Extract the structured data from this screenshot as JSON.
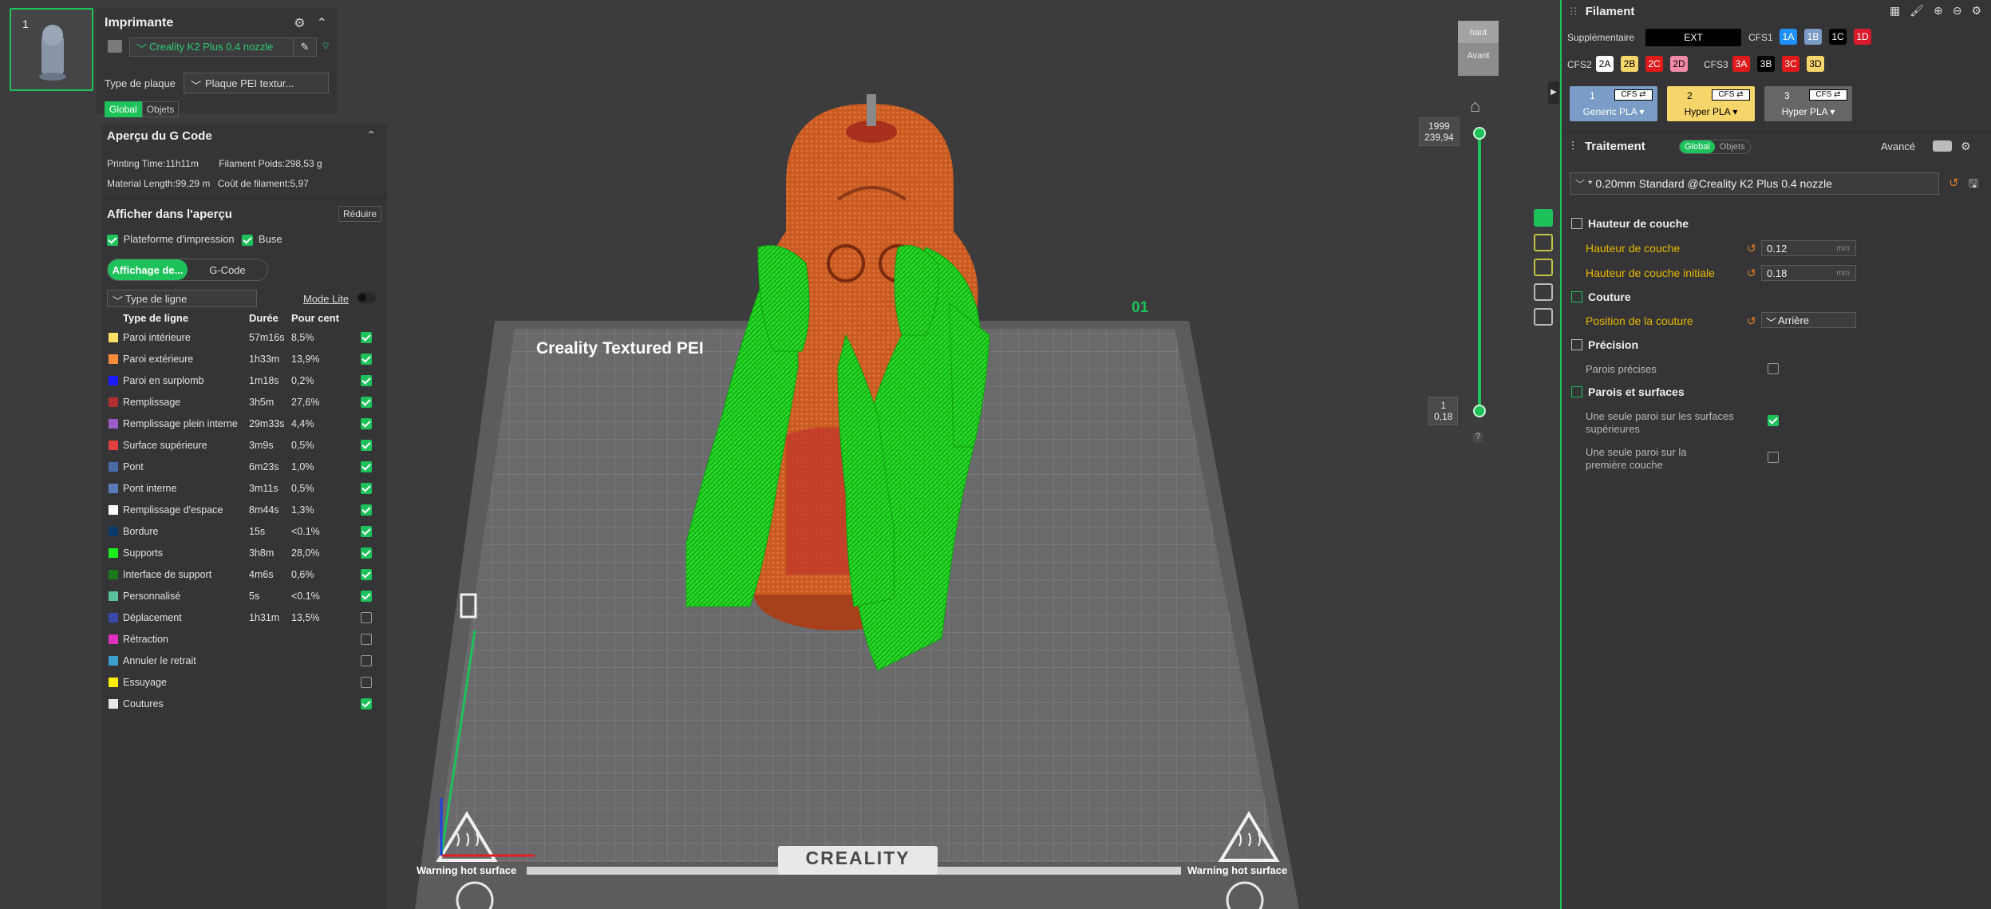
{
  "plate": {
    "number": "1"
  },
  "printer": {
    "title": "Imprimante",
    "name": "Creality K2 Plus 0.4 nozzle",
    "plate_label": "Type de plaque",
    "plate_value": "Plaque PEI textur...",
    "scope_global": "Global",
    "scope_objects": "Objets"
  },
  "gcode": {
    "title": "Aperçu du G Code",
    "printing_time": "Printing Time:11h11m",
    "filament_weight": "Filament Poids:298,53 g",
    "material_length": "Material Length:99,29 m",
    "filament_cost": "Coût de filament:5,97",
    "show_title": "Afficher dans l'aperçu",
    "reduce": "Réduire",
    "opt_plate": "Plateforme d'impression",
    "opt_nozzle": "Buse",
    "tab_display": "Affichage de...",
    "tab_gcode": "G-Code",
    "line_type_select": "Type de ligne",
    "lite_mode": "Mode Lite",
    "col_type": "Type de ligne",
    "col_duration": "Durée",
    "col_percent": "Pour cent",
    "rows": [
      {
        "name": "Paroi intérieure",
        "color": "#ffe066",
        "duration": "57m16s",
        "percent": "8,5%",
        "checked": true
      },
      {
        "name": "Paroi extérieure",
        "color": "#ff8c3a",
        "duration": "1h33m",
        "percent": "13,9%",
        "checked": true
      },
      {
        "name": "Paroi en surplomb",
        "color": "#1a1aff",
        "duration": "1m18s",
        "percent": "0,2%",
        "checked": true
      },
      {
        "name": "Remplissage",
        "color": "#b03030",
        "duration": "3h5m",
        "percent": "27,6%",
        "checked": true
      },
      {
        "name": "Remplissage plein interne",
        "color": "#9a5cc6",
        "duration": "29m33s",
        "percent": "4,4%",
        "checked": true
      },
      {
        "name": "Surface supérieure",
        "color": "#e04040",
        "duration": "3m9s",
        "percent": "0,5%",
        "checked": true
      },
      {
        "name": "Pont",
        "color": "#4a6aa8",
        "duration": "6m23s",
        "percent": "1,0%",
        "checked": true
      },
      {
        "name": "Pont interne",
        "color": "#5a7ab8",
        "duration": "3m11s",
        "percent": "0,5%",
        "checked": true
      },
      {
        "name": "Remplissage d'espace",
        "color": "#ffffff",
        "duration": "8m44s",
        "percent": "1,3%",
        "checked": true
      },
      {
        "name": "Bordure",
        "color": "#0a3a6a",
        "duration": "15s",
        "percent": "<0.1%",
        "checked": true
      },
      {
        "name": "Supports",
        "color": "#1aee1a",
        "duration": "3h8m",
        "percent": "28,0%",
        "checked": true
      },
      {
        "name": "Interface de support",
        "color": "#1a7a1a",
        "duration": "4m6s",
        "percent": "0,6%",
        "checked": true
      },
      {
        "name": "Personnalisé",
        "color": "#5ac29a",
        "duration": "5s",
        "percent": "<0.1%",
        "checked": true
      },
      {
        "name": "Déplacement",
        "color": "#3a4aa8",
        "duration": "1h31m",
        "percent": "13,5%",
        "checked": false
      },
      {
        "name": "Rétraction",
        "color": "#e030c0",
        "duration": "",
        "percent": "",
        "checked": false
      },
      {
        "name": "Annuler le retrait",
        "color": "#3aa0d0",
        "duration": "",
        "percent": "",
        "checked": false
      },
      {
        "name": "Essuyage",
        "color": "#ffee00",
        "duration": "",
        "percent": "",
        "checked": false
      },
      {
        "name": "Coutures",
        "color": "#e8e8e8",
        "duration": "",
        "percent": "",
        "checked": true
      }
    ]
  },
  "viewport": {
    "bed_label": "Creality Textured PEI",
    "bed_brand": "CREALITY",
    "plate_index": "01",
    "warning_left": "Warning hot surface",
    "warning_right": "Warning hot surface",
    "viewcube_top": "haut",
    "viewcube_front": "Avant",
    "layer_top_num": "1999",
    "layer_top_height": "239,94",
    "layer_bottom_num": "1",
    "layer_bottom_height": "0,18",
    "help": "?",
    "colors": {
      "orange": "#d8642a",
      "support_green": "#1ad61a",
      "accent": "#1ec25a"
    }
  },
  "filament": {
    "title": "Filament",
    "supplementary": "Supplémentaire",
    "ext": "EXT",
    "cfs1": "CFS1",
    "cfs2": "CFS2",
    "cfs3": "CFS3",
    "slots_cfs1": [
      {
        "label": "1A",
        "bg": "#1e90ff",
        "fg": "#fff"
      },
      {
        "label": "1B",
        "bg": "#7a9cc6",
        "fg": "#fff"
      },
      {
        "label": "1C",
        "bg": "#000000",
        "fg": "#fff"
      },
      {
        "label": "1D",
        "bg": "#d81a2a",
        "fg": "#fff"
      }
    ],
    "slots_cfs2": [
      {
        "label": "2A",
        "bg": "#ffffff",
        "fg": "#000"
      },
      {
        "label": "2B",
        "bg": "#f6d66a",
        "fg": "#000"
      },
      {
        "label": "2C",
        "bg": "#e01a1a",
        "fg": "#fff"
      },
      {
        "label": "2D",
        "bg": "#f08aa8",
        "fg": "#000"
      }
    ],
    "slots_cfs3": [
      {
        "label": "3A",
        "bg": "#e01a1a",
        "fg": "#fff"
      },
      {
        "label": "3B",
        "bg": "#000000",
        "fg": "#fff"
      },
      {
        "label": "3C",
        "bg": "#e01a1a",
        "fg": "#fff"
      },
      {
        "label": "3D",
        "bg": "#f6d66a",
        "fg": "#000"
      }
    ],
    "cards": [
      {
        "num": "1",
        "badge": "CFS ⇄",
        "name": "Generic PLA ▾",
        "bg": "#7a9cc6"
      },
      {
        "num": "2",
        "badge": "CFS ⇄",
        "name": "Hyper PLA ▾",
        "bg": "#f6d66a"
      },
      {
        "num": "3",
        "badge": "CFS ⇄",
        "name": "Hyper PLA ▾",
        "bg": "#666668"
      }
    ]
  },
  "process": {
    "title": "Traitement",
    "seg_global": "Global",
    "seg_objects": "Objets",
    "advanced": "Avancé",
    "profile": "* 0.20mm Standard @Creality K2 Plus 0.4 nozzle",
    "sections": {
      "layer_height": "Hauteur de couche",
      "seam": "Couture",
      "precision": "Précision",
      "walls": "Parois et surfaces"
    },
    "layer_height_label": "Hauteur de couche",
    "layer_height_value": "0.12",
    "initial_layer_label": "Hauteur de couche initiale",
    "initial_layer_value": "0.18",
    "unit": "mm",
    "seam_label": "Position de la couture",
    "seam_value": "Arrière",
    "precise_walls": "Parois précises",
    "single_wall_top_1": "Une seule paroi sur les surfaces",
    "single_wall_top_2": "supérieures",
    "single_wall_first_1": "Une seule paroi sur la",
    "single_wall_first_2": "première couche"
  }
}
